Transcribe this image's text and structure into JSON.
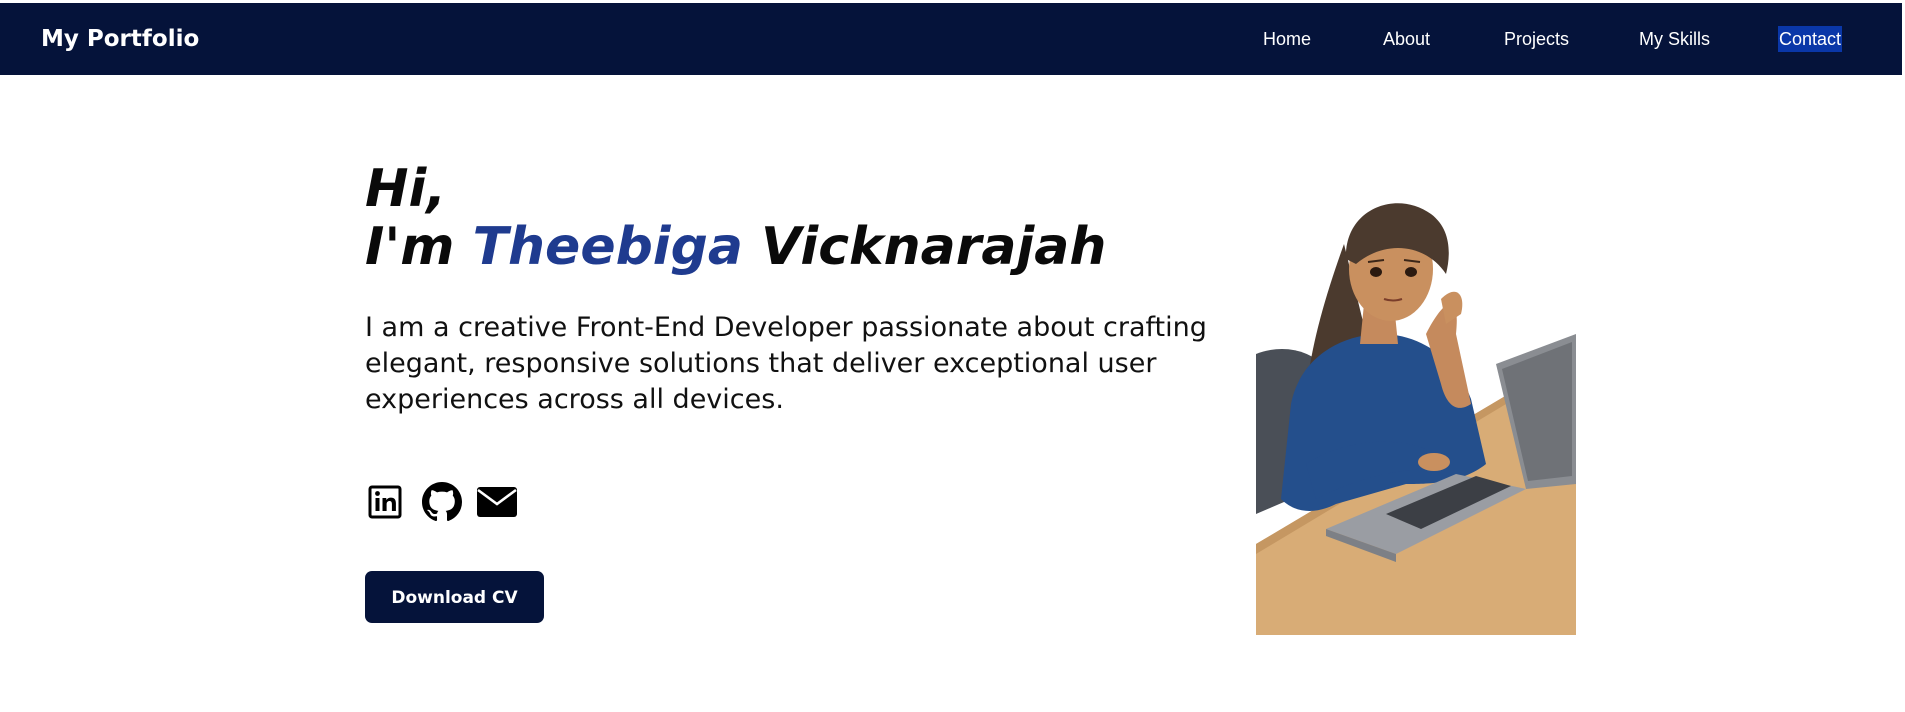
{
  "navbar": {
    "brand": "My Portfolio",
    "links": [
      {
        "label": "Home"
      },
      {
        "label": "About"
      },
      {
        "label": "Projects"
      },
      {
        "label": "My Skills"
      },
      {
        "label": "Contact"
      }
    ]
  },
  "hero": {
    "greeting_line1": "Hi,",
    "greeting_prefix": "I'm ",
    "first_name": "Theebiga",
    "last_name": " Vicknarajah",
    "intro": "I am a creative Front-End Developer passionate about crafting elegant, responsive solutions that deliver exceptional user experiences across all devices.",
    "download_label": "Download CV"
  },
  "socials": [
    {
      "icon": "linkedin-icon"
    },
    {
      "icon": "github-icon"
    },
    {
      "icon": "email-icon"
    }
  ],
  "colors": {
    "navbar_bg": "#05133a",
    "highlight": "#1f3b8f",
    "contact_active_bg": "#0a37a8",
    "button_bg": "#05133a"
  }
}
